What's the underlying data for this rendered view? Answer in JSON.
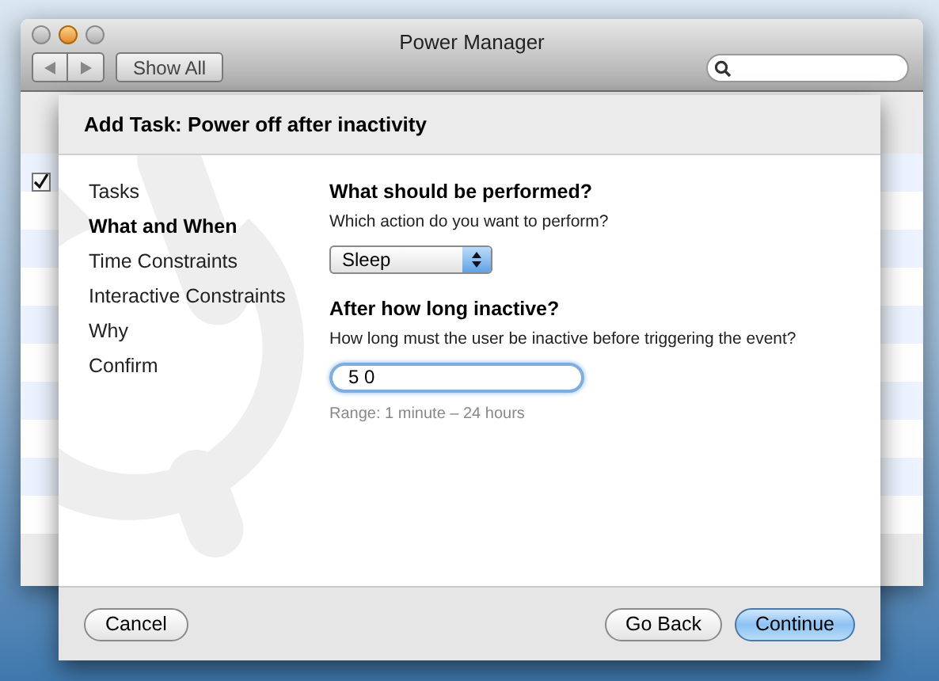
{
  "window": {
    "title": "Power Manager"
  },
  "toolbar": {
    "show_all": "Show All"
  },
  "background_list": {
    "checked": true
  },
  "sheet": {
    "title": "Add Task: Power off after inactivity",
    "steps": [
      {
        "label": "Tasks",
        "selected": false
      },
      {
        "label": "What and When",
        "selected": true
      },
      {
        "label": "Time Constraints",
        "selected": false
      },
      {
        "label": "Interactive Constraints",
        "selected": false
      },
      {
        "label": "Why",
        "selected": false
      },
      {
        "label": "Confirm",
        "selected": false
      }
    ],
    "sections": [
      {
        "kind": "popup",
        "heading": "What should be performed?",
        "prompt": "Which action do you want to perform?",
        "value": "Sleep"
      },
      {
        "kind": "field",
        "heading": "After how long inactive?",
        "prompt": "How long must the user be inactive before triggering the event?",
        "value": "5 0",
        "hint": "Range: 1 minute – 24 hours"
      }
    ],
    "left_buttons": [
      {
        "label": "Cancel",
        "default": false
      }
    ],
    "right_buttons": [
      {
        "label": "Go Back",
        "default": false
      },
      {
        "label": "Continue",
        "default": true
      }
    ]
  }
}
